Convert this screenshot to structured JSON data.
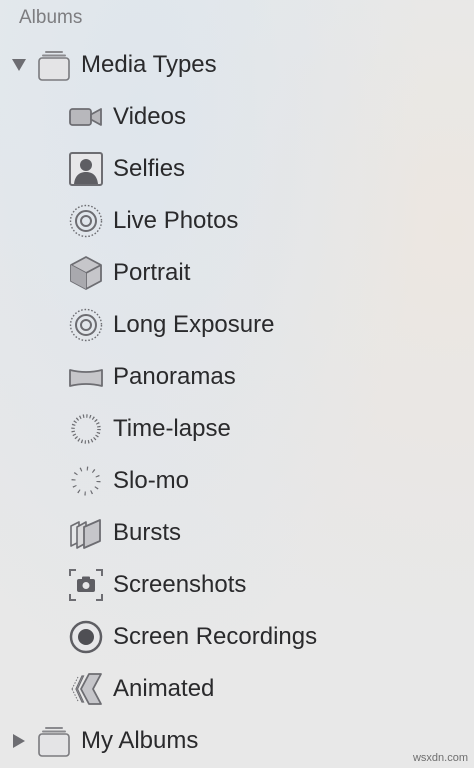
{
  "section": {
    "title": "Albums"
  },
  "media_types": {
    "label": "Media Types",
    "expanded": true,
    "items": [
      {
        "label": "Videos",
        "icon": "video-camera-icon"
      },
      {
        "label": "Selfies",
        "icon": "person-portrait-icon"
      },
      {
        "label": "Live Photos",
        "icon": "live-photo-icon"
      },
      {
        "label": "Portrait",
        "icon": "cube-icon"
      },
      {
        "label": "Long Exposure",
        "icon": "long-exposure-icon"
      },
      {
        "label": "Panoramas",
        "icon": "panorama-icon"
      },
      {
        "label": "Time-lapse",
        "icon": "timelapse-icon"
      },
      {
        "label": "Slo-mo",
        "icon": "slomo-icon"
      },
      {
        "label": "Bursts",
        "icon": "bursts-icon"
      },
      {
        "label": "Screenshots",
        "icon": "screenshot-camera-icon"
      },
      {
        "label": "Screen Recordings",
        "icon": "screen-recording-icon"
      },
      {
        "label": "Animated",
        "icon": "animated-icon"
      }
    ]
  },
  "my_albums": {
    "label": "My Albums",
    "expanded": false
  },
  "watermark": "wsxdn.com",
  "colors": {
    "icon": "#6d6d72",
    "text": "#2a2a2c",
    "header": "#7d7d80"
  }
}
